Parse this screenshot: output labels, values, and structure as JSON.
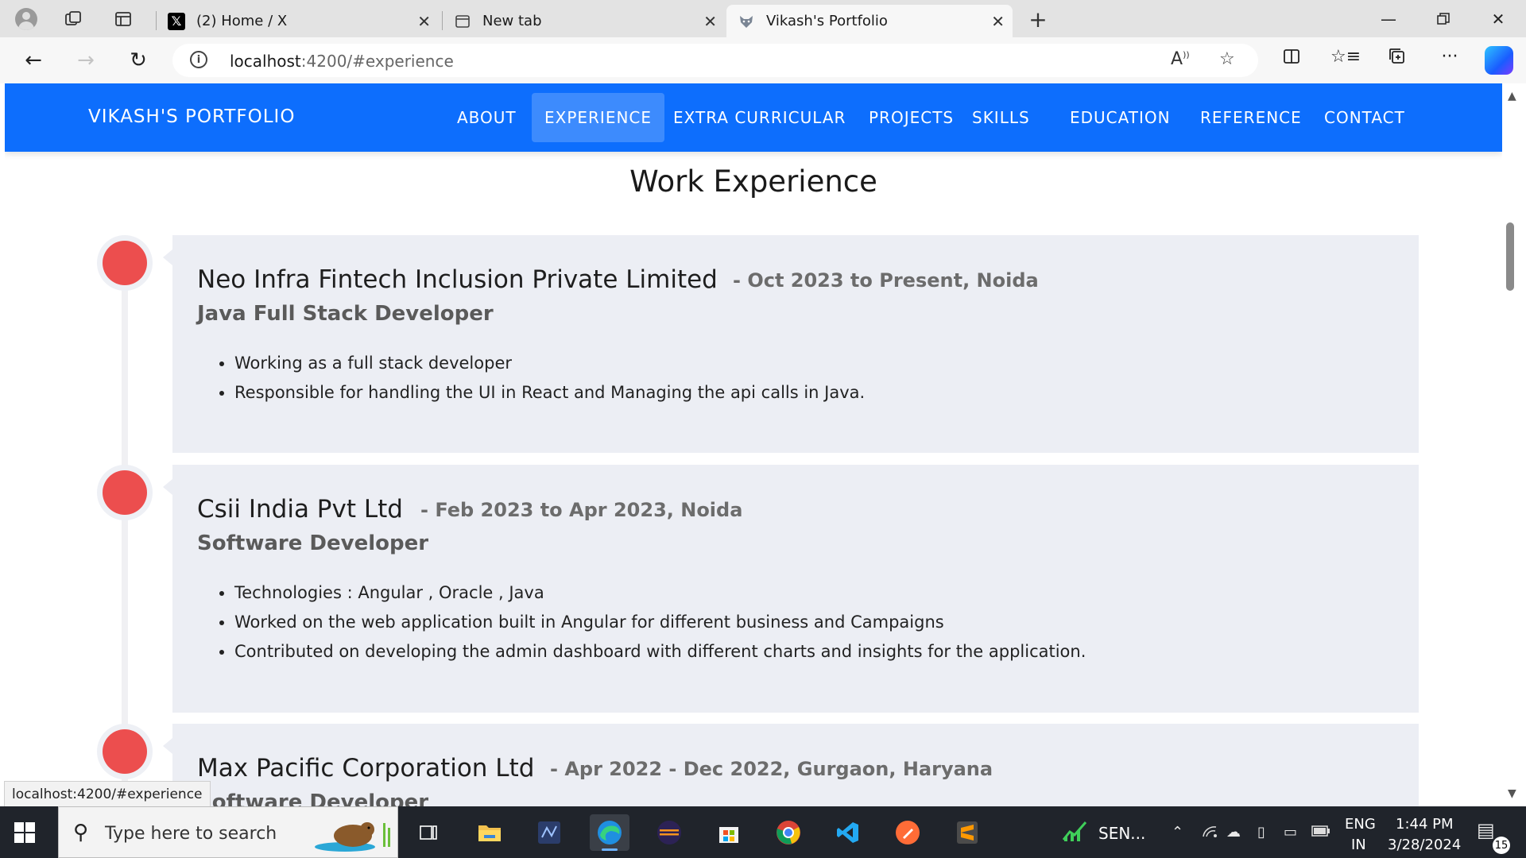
{
  "browser": {
    "tabs": [
      {
        "title": "(2) Home / X",
        "icon": "x-logo-icon"
      },
      {
        "title": "New tab",
        "icon": "new-tab-icon"
      },
      {
        "title": "Vikash's Portfolio",
        "icon": "wolf-favicon-icon",
        "active": true
      }
    ],
    "url_host": "localhost",
    "url_rest": ":4200/#experience",
    "status_url": "localhost:4200/#experience"
  },
  "site": {
    "brand": "VIKASH'S PORTFOLIO",
    "nav": [
      "ABOUT",
      "EXPERIENCE",
      "EXTRA CURRICULAR",
      "PROJECTS",
      "SKILLS",
      "EDUCATION",
      "REFERENCE",
      "CONTACT"
    ],
    "active_nav": "EXPERIENCE",
    "section_title": "Work Experience",
    "jobs": [
      {
        "company": "Neo Infra Fintech Inclusion Private Limited",
        "dates": "- Oct 2023 to Present, Noida",
        "role": "Java Full Stack Developer",
        "bullets": [
          "Working as a full stack developer",
          "Responsible for handling the UI in React and Managing the api calls in Java."
        ]
      },
      {
        "company": "Csii India Pvt Ltd",
        "dates": "- Feb 2023 to Apr 2023, Noida",
        "role": "Software Developer",
        "bullets": [
          "Technologies : Angular , Oracle , Java",
          "Worked on the web application built in Angular for different business and Campaigns",
          "Contributed on developing the admin dashboard with different charts and insights for the application."
        ]
      },
      {
        "company": "Max Pacific Corporation Ltd",
        "dates": "- Apr 2022 - Dec 2022, Gurgaon, Haryana",
        "role": "Software Developer",
        "bullets": []
      }
    ],
    "colors": {
      "nav_bg": "#0d6efd",
      "nav_active": "#3d8bfd",
      "dot": "#ec4e4e",
      "card_bg": "#eceef4"
    }
  },
  "taskbar": {
    "search_placeholder": "Type here to search",
    "tray_app_label": "SEN...",
    "language": "ENG",
    "region": "IN",
    "time": "1:44 PM",
    "date": "3/28/2024",
    "notifications": "15"
  }
}
